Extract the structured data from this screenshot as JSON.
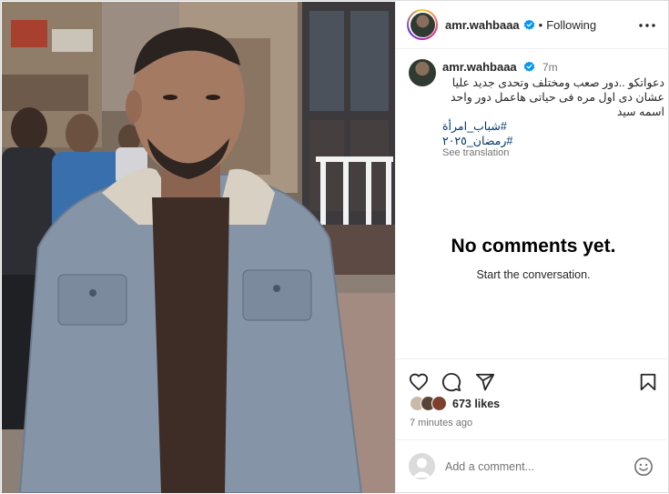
{
  "post": {
    "username": "amr.wahbaaa",
    "follow_status": "Following",
    "separator": "•"
  },
  "caption": {
    "username": "amr.wahbaaa",
    "time": "7m",
    "text": "دعواتكو ..دور صعب ومختلف وتحدى جديد عليا عشان دى اول مره فى حياتى هاعمل دور واحد اسمه سيد",
    "hashtags": [
      "#شباب_امرأة",
      "#رمضان_٢٠٢٥"
    ],
    "see_translation": "See translation"
  },
  "comments": {
    "empty_title": "No comments yet.",
    "empty_subtitle": "Start the conversation."
  },
  "engagement": {
    "likes": "673 likes",
    "time_ago": "7 minutes ago"
  },
  "comment_box": {
    "placeholder": "Add a comment..."
  },
  "icons": {
    "verified": "verified-badge-icon",
    "more": "more-options-icon",
    "like": "heart-icon",
    "comment": "comment-icon",
    "share": "share-icon",
    "save": "bookmark-icon",
    "emoji": "emoji-icon"
  },
  "colors": {
    "verified_blue": "#0095f6",
    "hashtag": "#00376b",
    "secondary_text": "#737373",
    "border": "#efefef"
  }
}
